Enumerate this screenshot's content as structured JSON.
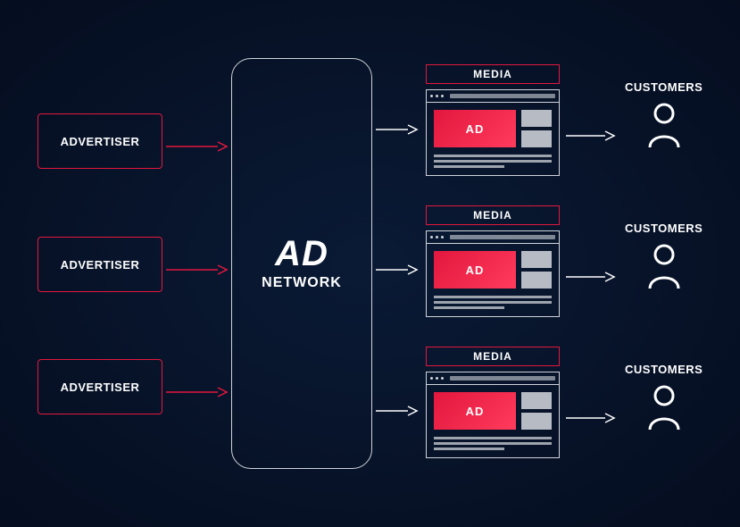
{
  "advertisers": [
    {
      "label": "ADVERTISER"
    },
    {
      "label": "ADVERTISER"
    },
    {
      "label": "ADVERTISER"
    }
  ],
  "network": {
    "title": "AD",
    "subtitle": "NETWORK"
  },
  "media": [
    {
      "label": "MEDIA",
      "ad_text": "AD"
    },
    {
      "label": "MEDIA",
      "ad_text": "AD"
    },
    {
      "label": "MEDIA",
      "ad_text": "AD"
    }
  ],
  "customers": [
    {
      "label": "CUSTOMERS"
    },
    {
      "label": "CUSTOMERS"
    },
    {
      "label": "CUSTOMERS"
    }
  ],
  "colors": {
    "accent": "#e3173e",
    "outline": "#cfd4da"
  }
}
